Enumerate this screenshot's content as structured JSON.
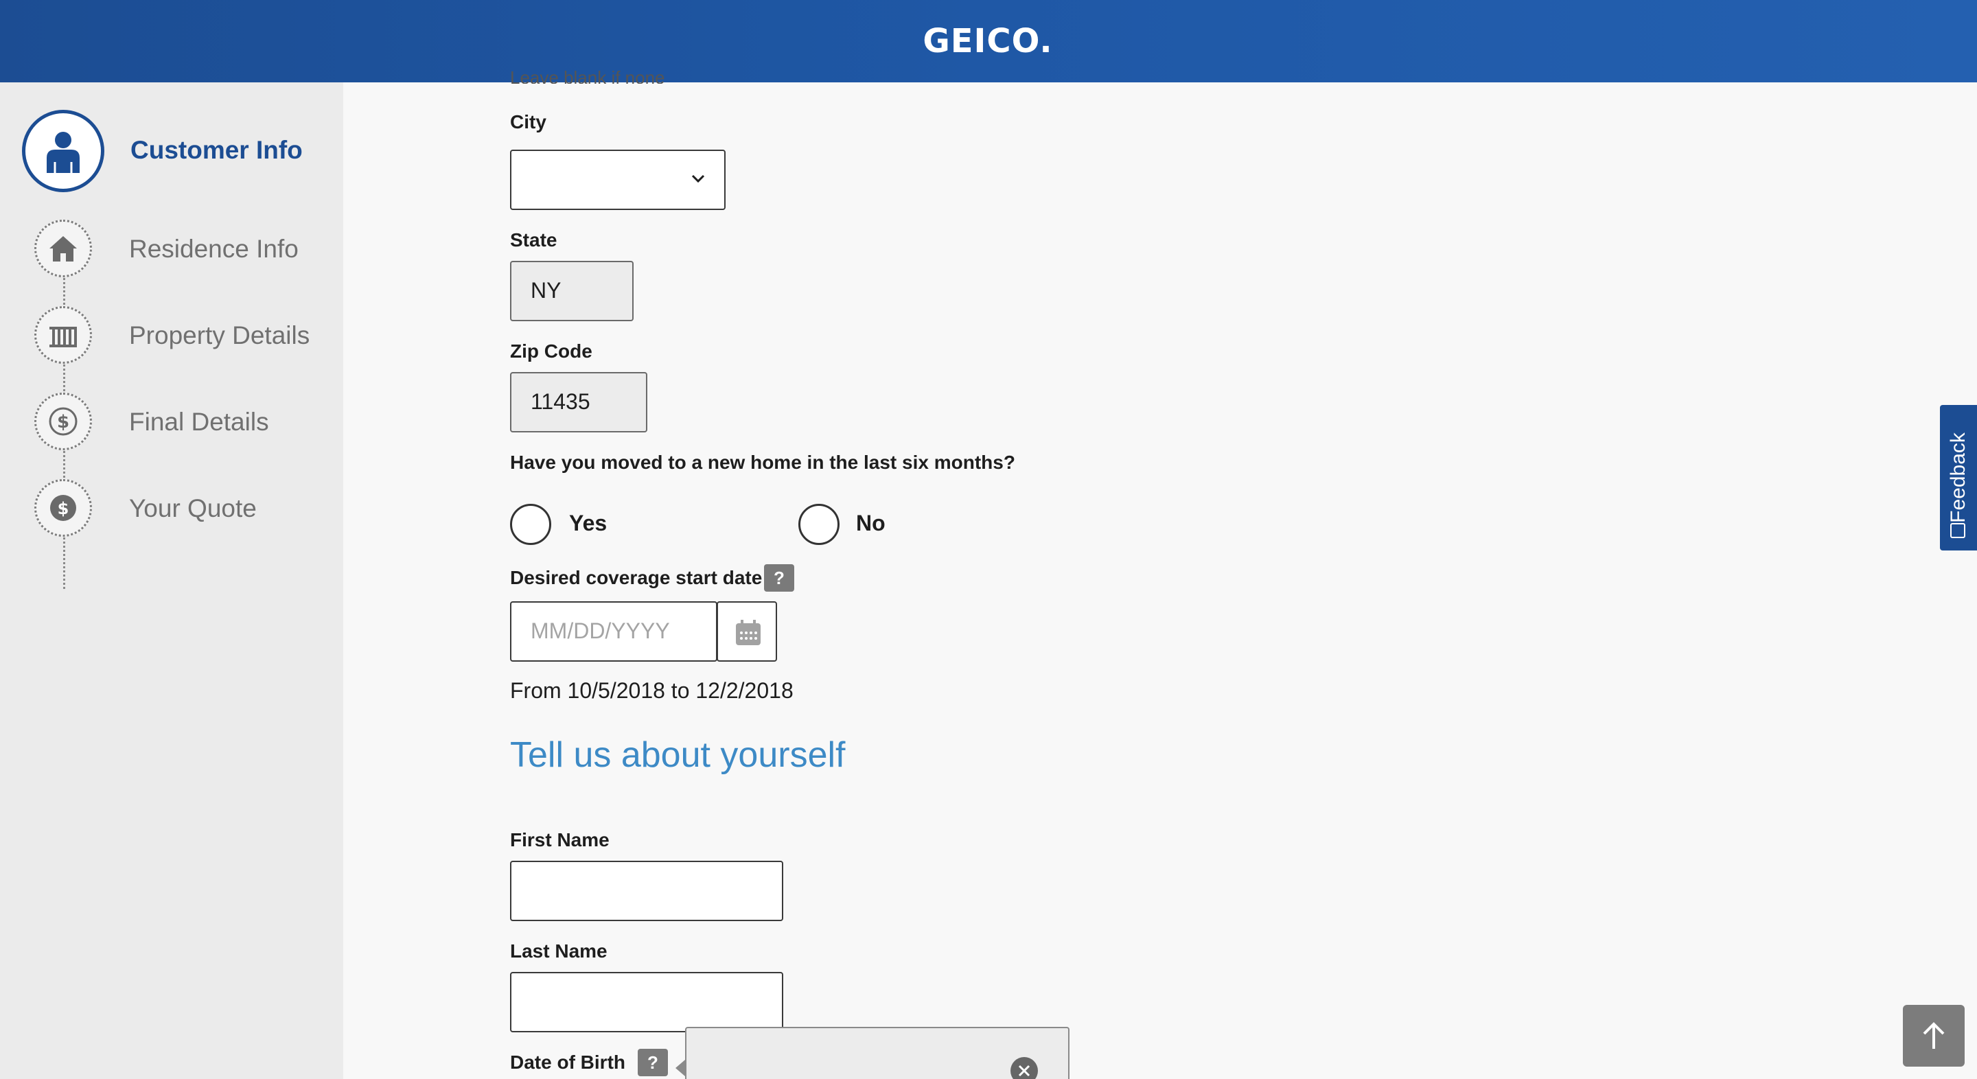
{
  "brand": {
    "logo_text": "GEICO.",
    "header_color": "#1c4d93",
    "accent_color": "#3d8ac6"
  },
  "sidebar": {
    "steps": [
      {
        "label": "Customer Info",
        "icon": "person-icon",
        "active": true
      },
      {
        "label": "Residence Info",
        "icon": "house-icon",
        "active": false
      },
      {
        "label": "Property Details",
        "icon": "fence-icon",
        "active": false
      },
      {
        "label": "Final Details",
        "icon": "dollar-circle-icon",
        "active": false
      },
      {
        "label": "Your Quote",
        "icon": "dollar-badge-icon",
        "active": false
      }
    ]
  },
  "form": {
    "cut_off_hint": "Leave blank if none",
    "city": {
      "label": "City",
      "value": ""
    },
    "state": {
      "label": "State",
      "value": "NY"
    },
    "zip": {
      "label": "Zip Code",
      "value": "11435"
    },
    "moved": {
      "question": "Have you moved to a new home in the last six months?",
      "options": [
        "Yes",
        "No"
      ]
    },
    "coverage_start": {
      "label": "Desired coverage start date",
      "help": "?",
      "placeholder": "MM/DD/YYYY",
      "range_text": "From 10/5/2018 to 12/2/2018"
    },
    "about_title": "Tell us about yourself",
    "first_name": {
      "label": "First Name",
      "value": ""
    },
    "last_name": {
      "label": "Last Name",
      "value": ""
    },
    "dob": {
      "label": "Date of Birth",
      "help": "?"
    }
  },
  "feedback": {
    "label": "Feedback"
  }
}
